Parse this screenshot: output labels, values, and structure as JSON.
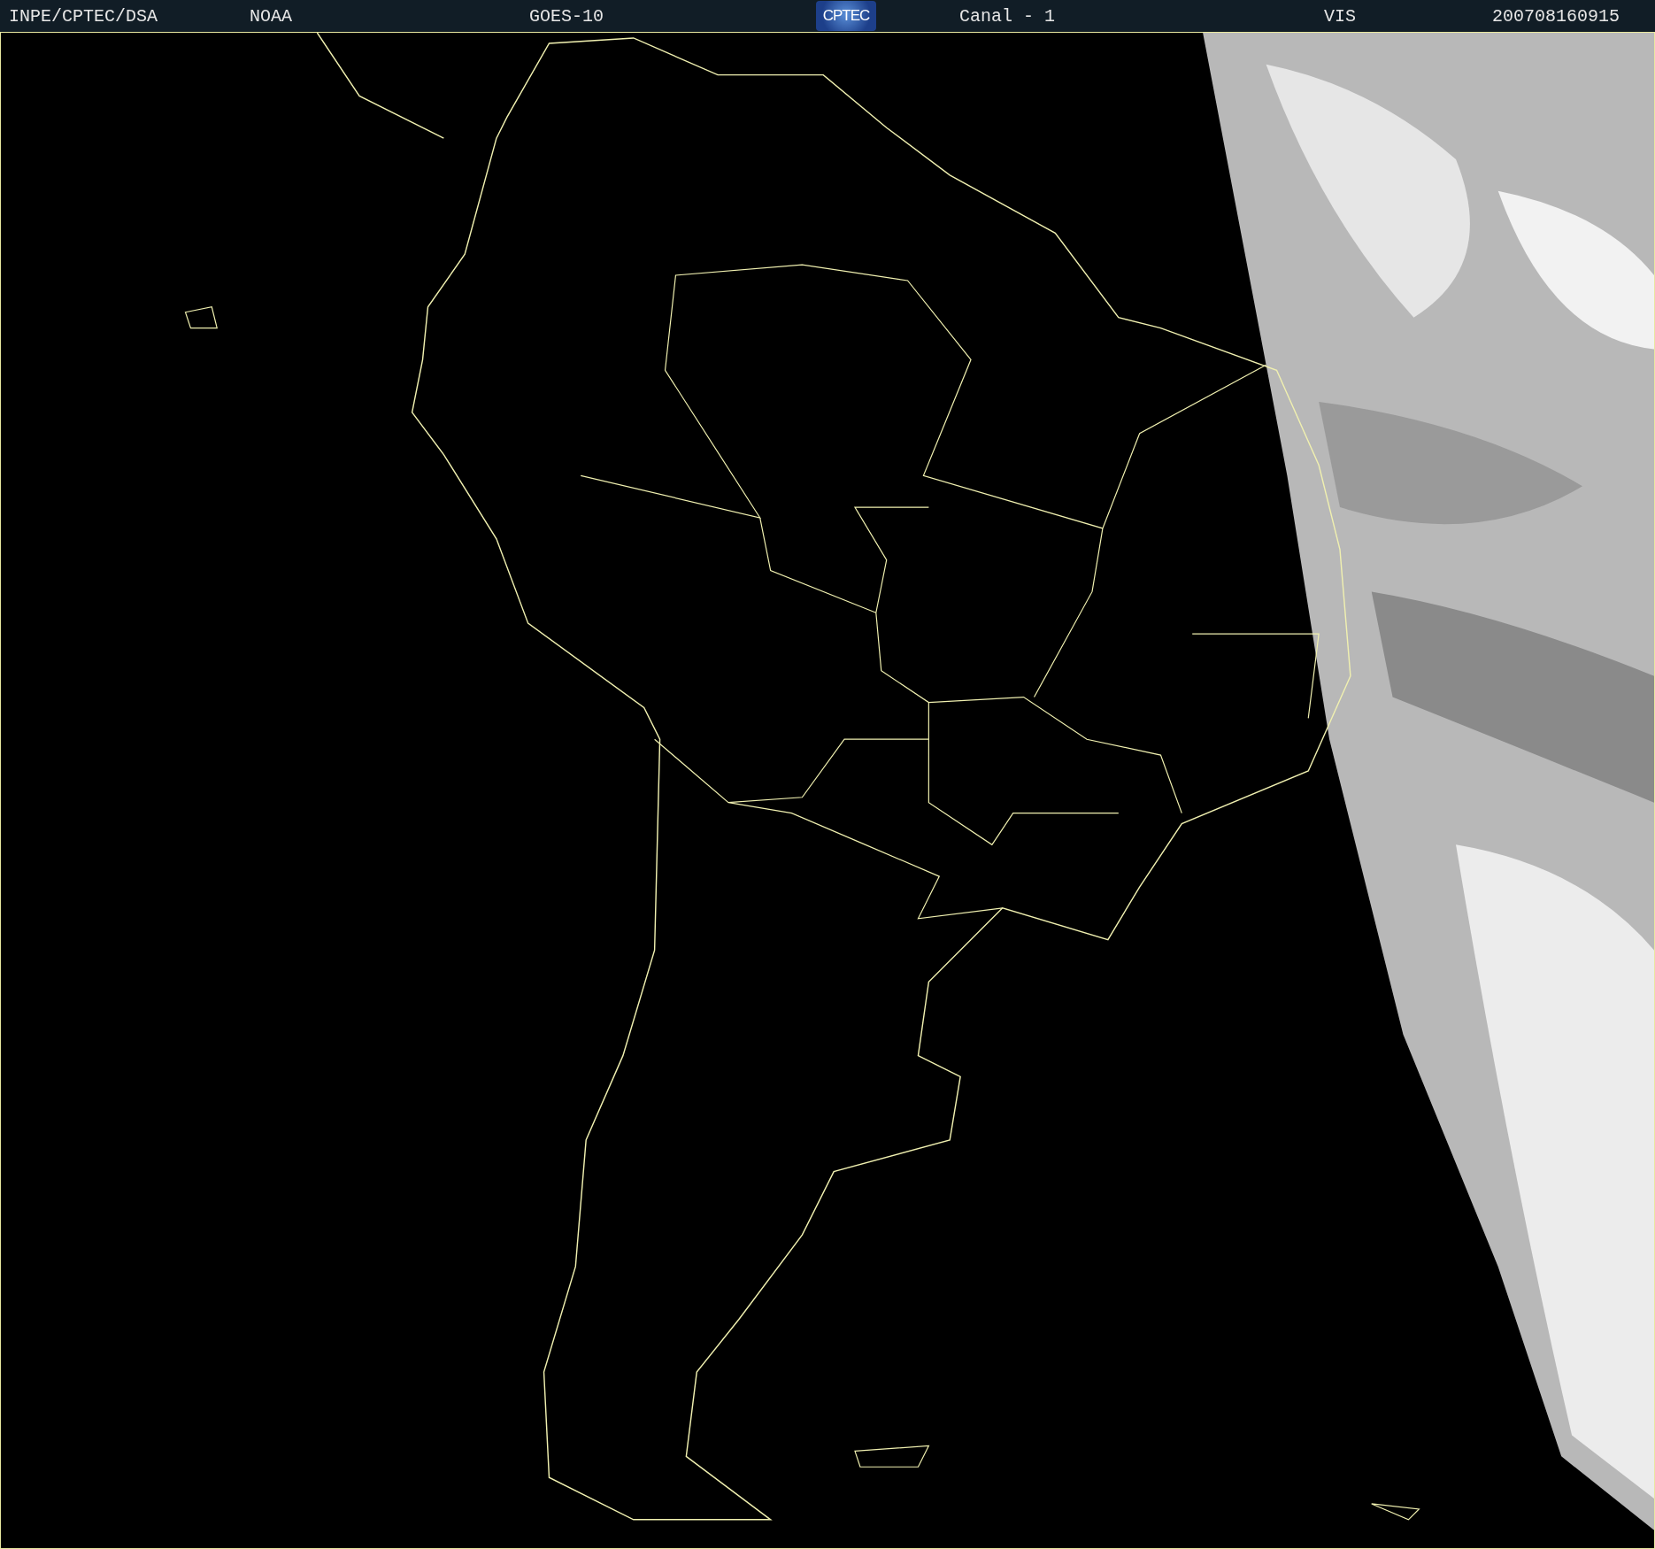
{
  "header": {
    "items": [
      {
        "kind": "text",
        "text": "INPE/CPTEC/DSA"
      },
      {
        "kind": "text",
        "text": "NOAA"
      },
      {
        "kind": "text",
        "text": "GOES-10"
      },
      {
        "kind": "logo",
        "text": "CPTEC"
      },
      {
        "kind": "text",
        "text": "Canal - 1"
      },
      {
        "kind": "text",
        "text": "VIS"
      },
      {
        "kind": "text",
        "text": "200708160915"
      }
    ]
  }
}
